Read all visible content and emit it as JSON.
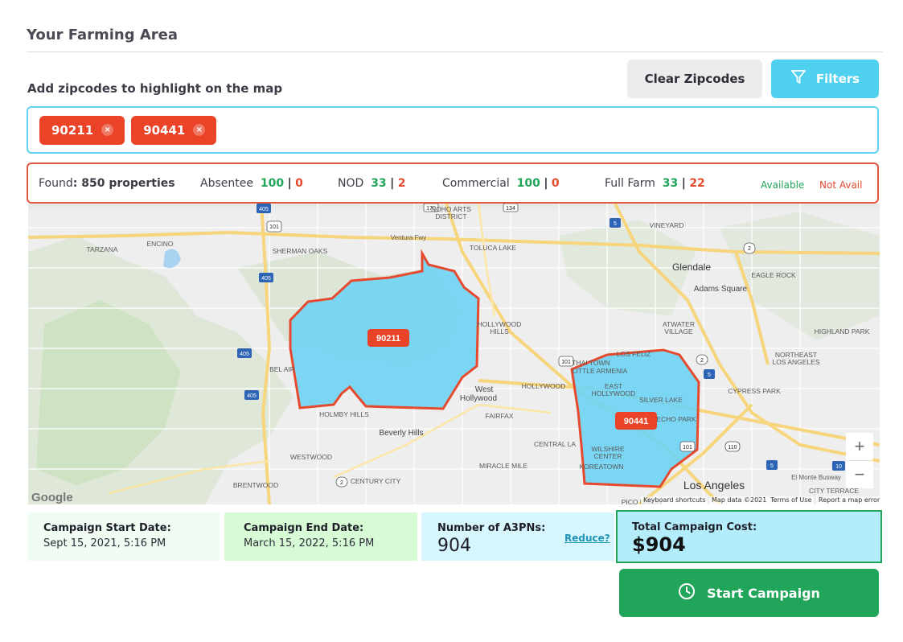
{
  "page": {
    "title": "Your Farming Area",
    "zip_prompt": "Add zipcodes to highlight on the map"
  },
  "toolbar": {
    "clear_label": "Clear Zipcodes",
    "filters_label": "Filters",
    "filters_icon": "filter-funnel-icon"
  },
  "zipcodes": {
    "chips": [
      {
        "code": "90211",
        "remove_icon": "×"
      },
      {
        "code": "90441",
        "remove_icon": "×"
      }
    ]
  },
  "stats": {
    "found_label": "Found",
    "found_value": ": 850 properties",
    "separator": "|",
    "items": [
      {
        "label": "Absentee",
        "available": "100",
        "not_available": "0"
      },
      {
        "label": "NOD",
        "available": "33",
        "not_available": "2"
      },
      {
        "label": "Commercial",
        "available": "100",
        "not_available": "0"
      },
      {
        "label": "Full Farm",
        "available": "33",
        "not_available": "22"
      }
    ],
    "legend_available": "Available",
    "legend_not_available": "Not Avail"
  },
  "map": {
    "place_labels": {
      "tarzana": "TARZANA",
      "encino": "ENCINO",
      "sherman_oaks": "SHERMAN OAKS",
      "noho_1": "NOHO ARTS",
      "noho_2": "DISTRICT",
      "ventura_fwy": "Ventura Fwy",
      "toluca_lake": "TOLUCA LAKE",
      "vineyard": "VINEYARD",
      "glendale": "Glendale",
      "adams_square": "Adams Square",
      "eagle_rock": "EAGLE ROCK",
      "hollywood_hills_1": "HOLLYWOOD",
      "hollywood_hills_2": "HILLS",
      "atwater_1": "ATWATER",
      "atwater_2": "VILLAGE",
      "highland_park": "HIGHLAND PARK",
      "los_feliz": "LOS FELIZ",
      "thai_town": "THAI TOWN",
      "little_armenia": "LITTLE ARMENIA",
      "northeast_la_1": "NORTHEAST",
      "northeast_la_2": "LOS ANGELES",
      "bel_air": "BEL AIR",
      "west_hollywood_1": "West",
      "west_hollywood_2": "Hollywood",
      "hollywood": "HOLLYWOOD",
      "east_hollywood_1": "EAST",
      "east_hollywood_2": "HOLLYWOOD",
      "silver_lake": "SILVER LAKE",
      "cypress_park": "CYPRESS PARK",
      "holmby_hills": "HOLMBY HILLS",
      "fairfax": "FAIRFAX",
      "echo_park": "ECHO PARK",
      "beverly_hills": "Beverly Hills",
      "central_la": "CENTRAL LA",
      "wilshire_1": "WILSHIRE",
      "wilshire_2": "CENTER",
      "koreatown": "KOREATOWN",
      "westwood": "WESTWOOD",
      "miracle_mile": "MIRACLE MILE",
      "el_monte_busway": "El Monte Busway",
      "los_angeles": "Los Angeles",
      "brentwood": "BRENTWOOD",
      "century_city": "CENTURY CITY",
      "pico_union": "PICO UNION",
      "city_terrace": "CITY TERRACE"
    },
    "shields": [
      "405",
      "101",
      "170",
      "134",
      "5",
      "2",
      "110",
      "10",
      "405",
      "405",
      "101",
      "2",
      "5",
      "405",
      "2",
      "101",
      "5"
    ],
    "zip_markers": [
      {
        "code": "90211"
      },
      {
        "code": "90441"
      }
    ],
    "fill_color": "#6ed3f3",
    "outline_color": "#e64a2e",
    "google_logo": "Google",
    "attributions": [
      "Keyboard shortcuts",
      "Map data ©2021",
      "Terms of Use",
      "Report a map error"
    ],
    "zoom_in": "+",
    "zoom_out": "−"
  },
  "campaign": {
    "start_label": "Campaign Start Date:",
    "start_value": "Sept 15, 2021, 5:16 PM",
    "end_label": "Campaign End Date:",
    "end_value": "March 15, 2022, 5:16 PM",
    "apn_label": "Number of A3PNs:",
    "apn_value": "904",
    "reduce_label": "Reduce?",
    "cost_label": "Total Campaign Cost:",
    "cost_value": "$904",
    "start_button_label": "Start Campaign",
    "start_button_icon": "clock-icon"
  },
  "colors": {
    "accent_cyan": "#4fd0ef",
    "chip_red": "#ea4327",
    "available_green": "#21a55a",
    "not_available_red": "#e64a2e"
  }
}
